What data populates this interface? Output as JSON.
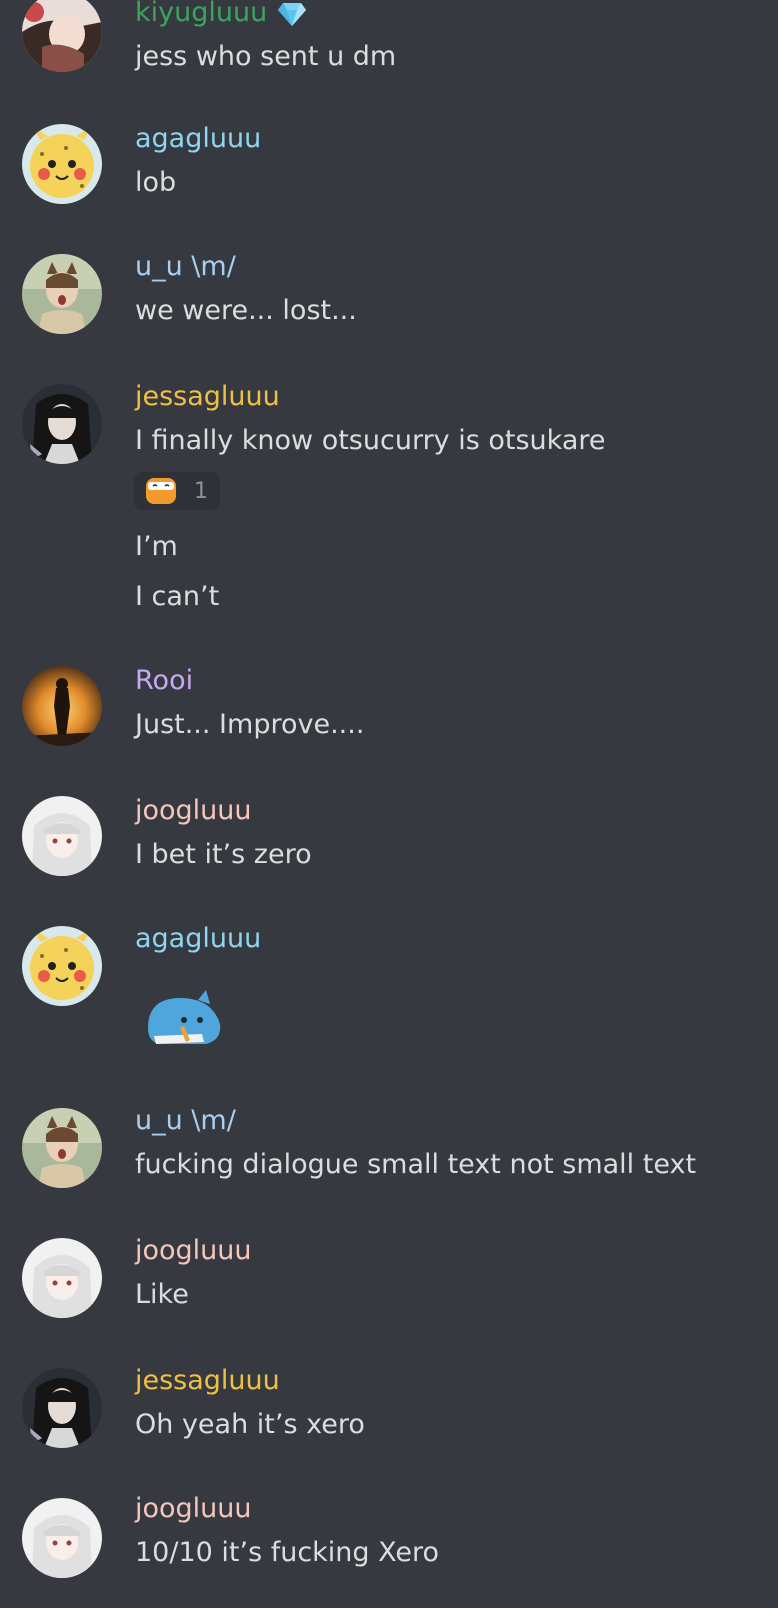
{
  "colors": {
    "background": "#36393f",
    "text": "#dcddde",
    "kiyugluuu": "#3ba55c",
    "agagluuu": "#8fd4f0",
    "u_u": "#a8cff0",
    "jessagluuu": "#f0c043",
    "rooi": "#c9a8f0",
    "joogluuu": "#f5c6bb"
  },
  "messages": [
    {
      "username": "kiyugluuu",
      "badge": "gem-icon",
      "lines": [
        "jess who sent u dm"
      ]
    },
    {
      "username": "agagluuu",
      "lines": [
        "lob"
      ]
    },
    {
      "username": "u_u \\m/",
      "lines": [
        "we were... lost..."
      ]
    },
    {
      "username": "jessagluuu",
      "lines": [
        "I finally know otsucurry is otsukare",
        "I’m",
        "I can’t"
      ],
      "reaction": {
        "emoji": "cat-face-emoji",
        "count": "1"
      }
    },
    {
      "username": "Rooi",
      "lines": [
        "Just... Improve...."
      ]
    },
    {
      "username": "joogluuu",
      "lines": [
        "I bet it’s zero"
      ]
    },
    {
      "username": "agagluuu",
      "sticker": "blue-cat-sticker"
    },
    {
      "username": "u_u \\m/",
      "lines": [
        "fucking dialogue small text not small text"
      ]
    },
    {
      "username": "joogluuu",
      "lines": [
        "Like"
      ]
    },
    {
      "username": "jessagluuu",
      "lines": [
        "Oh yeah it’s xero"
      ]
    },
    {
      "username": "joogluuu",
      "lines": [
        "10/10 it’s fucking Xero"
      ]
    }
  ]
}
